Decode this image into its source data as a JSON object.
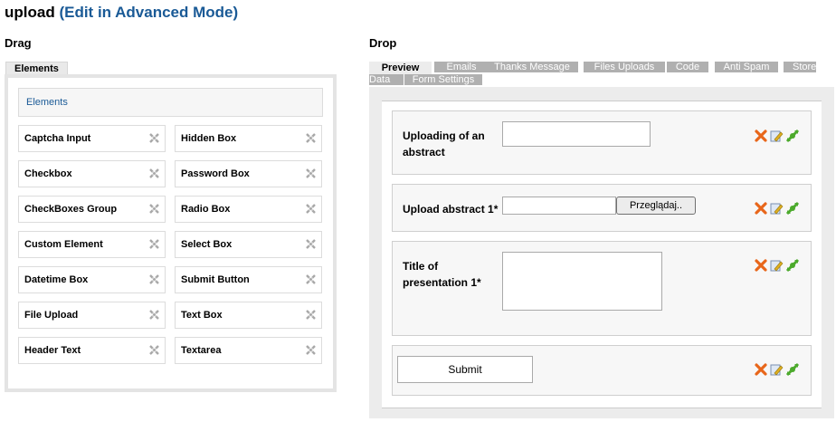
{
  "header": {
    "title": "upload",
    "link": "(Edit in Advanced Mode)"
  },
  "drag": {
    "heading": "Drag",
    "tab": "Elements",
    "elements_title": "Elements",
    "left_items": [
      "Captcha Input",
      "Checkbox",
      "CheckBoxes Group",
      "Custom Element",
      "Datetime Box",
      "File Upload",
      "Header Text"
    ],
    "right_items": [
      "Hidden Box",
      "Password Box",
      "Radio Box",
      "Select Box",
      "Submit Button",
      "Text Box",
      "Textarea"
    ]
  },
  "drop": {
    "heading": "Drop",
    "tabs": [
      "Preview",
      "Emails",
      "Thanks Message",
      "Files Uploads",
      "Code",
      "Anti Spam",
      "Store",
      "Data",
      "Form Settings"
    ],
    "fields": [
      {
        "label_l1": "Uploading of an",
        "label_l2": "abstract"
      },
      {
        "label": "Upload abstract 1*",
        "browse": "Przeglądaj.."
      },
      {
        "label_l1": "Title of",
        "label_l2": "presentation 1*"
      }
    ],
    "submit": "Submit"
  },
  "colors": {
    "link": "#1a5a96",
    "delete_icon": "#e8661a",
    "edit_icon": "#e0b020",
    "move_icon": "#4caa2c"
  }
}
